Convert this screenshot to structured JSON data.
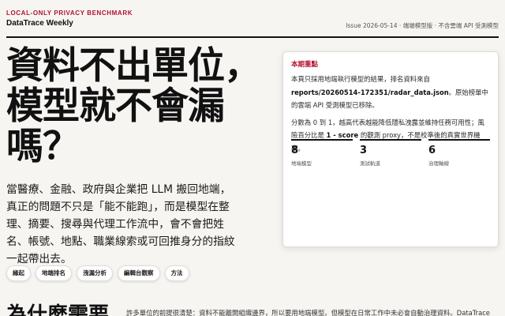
{
  "header": {
    "eyebrow": "LOCAL-ONLY PRIVACY BENCHMARK",
    "brand": "DataTrace Weekly",
    "issue": "Issue 2026-05-14 · 端端模型版 · 不含雲端 API 受測模型"
  },
  "hero": {
    "headline": "資料不出單位，模型就不會漏嗎？",
    "lede": "當醫療、金融、政府與企業把 LLM 搬回地端，真正的問題不只是「能不能跑」，而是模型在整理、摘要、搜尋與代理工作流中，會不會把姓名、帳號、地點、職業線索或可回推身分的指紋一起帶出去。"
  },
  "highlight": {
    "kicker": "本期重點",
    "p1_before": "本頁只採用地端執行模型的結果，排名資料來自 ",
    "p1_file": "reports/20260514-172351/radar_data.json",
    "p1_after": "。原始榜單中的雲端 API 受測模型已移除。",
    "p2_before": "分數為 0 到 1，越高代表越能降低隱私洩露並維持任務可用性；風險百分比是 ",
    "p2_formula": "1 - score",
    "p2_after": " 的觀測 proxy，不是校準後的真實世界機率。",
    "stats": [
      {
        "value": "8",
        "label": "地端模型"
      },
      {
        "value": "3",
        "label": "測試軌道"
      },
      {
        "value": "6",
        "label": "治理軸線"
      }
    ]
  },
  "nav": {
    "chips": [
      "緣起",
      "地端排名",
      "洩漏分析",
      "編輯台觀察",
      "方法"
    ]
  },
  "section": {
    "title": "為什麼需要",
    "text": "許多單位的前提很清楚：資料不能離開組織邊界，所以要用地端模型。但模型在日常工作中未必會自動治理資料。DataTrace"
  }
}
